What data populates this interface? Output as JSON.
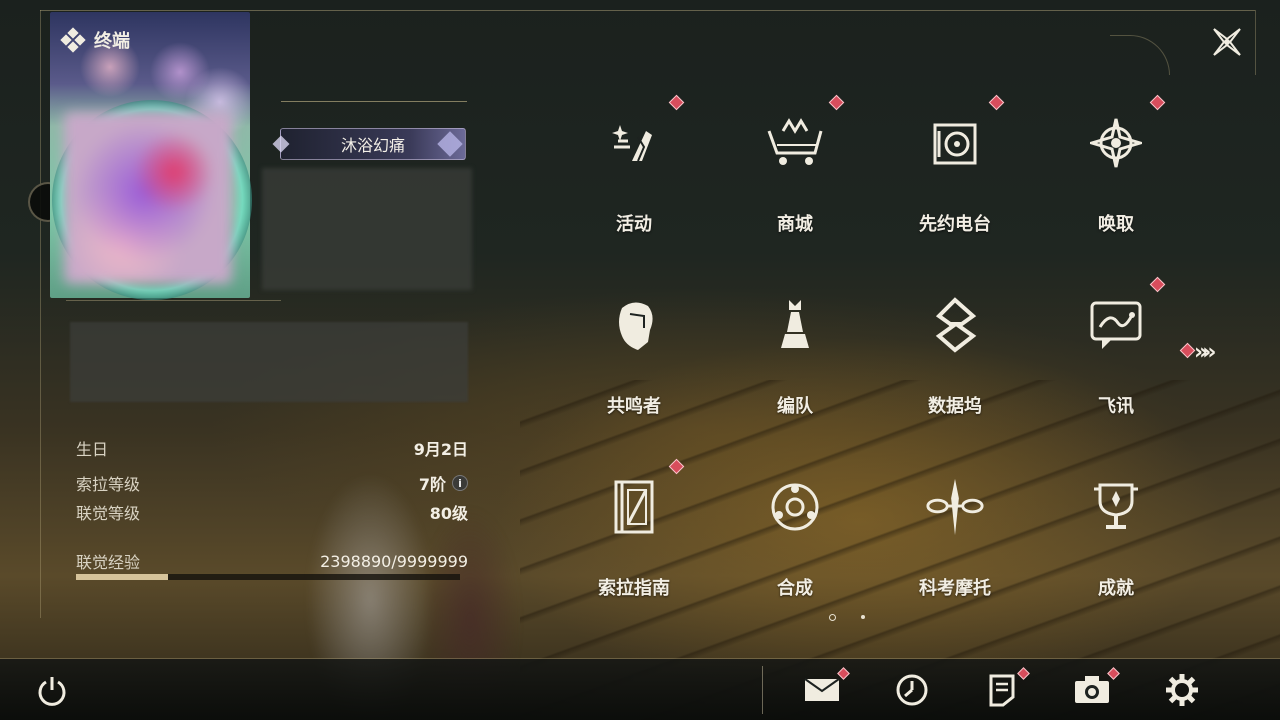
{
  "header": {
    "title": "终端"
  },
  "profile": {
    "title_badge": "沐浴幻痛",
    "stats": [
      {
        "label": "生日",
        "value": "9月2日"
      },
      {
        "label": "索拉等级",
        "value": "7阶"
      },
      {
        "label": "联觉等级",
        "value": "80级"
      }
    ],
    "xp": {
      "label": "联觉经验",
      "value": "2398890/9999999",
      "progress": 0.2399
    }
  },
  "menu": [
    {
      "label": "活动",
      "icon": "activity-icon",
      "badge": true
    },
    {
      "label": "商城",
      "icon": "shop-cart-icon",
      "badge": true
    },
    {
      "label": "先约电台",
      "icon": "radio-icon",
      "badge": true
    },
    {
      "label": "唤取",
      "icon": "convene-icon",
      "badge": true
    },
    {
      "label": "共鸣者",
      "icon": "resonator-icon",
      "badge": false
    },
    {
      "label": "编队",
      "icon": "team-chess-icon",
      "badge": false
    },
    {
      "label": "数据坞",
      "icon": "data-bank-icon",
      "badge": false
    },
    {
      "label": "飞讯",
      "icon": "chat-icon",
      "badge": true
    },
    {
      "label": "索拉指南",
      "icon": "guide-book-icon",
      "badge": true
    },
    {
      "label": "合成",
      "icon": "synthesis-icon",
      "badge": false
    },
    {
      "label": "科考摩托",
      "icon": "motorcycle-icon",
      "badge": false
    },
    {
      "label": "成就",
      "icon": "trophy-icon",
      "badge": false
    }
  ],
  "pager": {
    "pages": 2,
    "current": 1
  },
  "bottom_bar": [
    "power-icon",
    "mail-icon",
    "clock-icon",
    "notes-icon",
    "camera-icon",
    "settings-gear-icon"
  ],
  "colors": {
    "badge_red": "#d84d5c",
    "accent_gold": "#d6c39a",
    "text": "#f2eee4"
  }
}
